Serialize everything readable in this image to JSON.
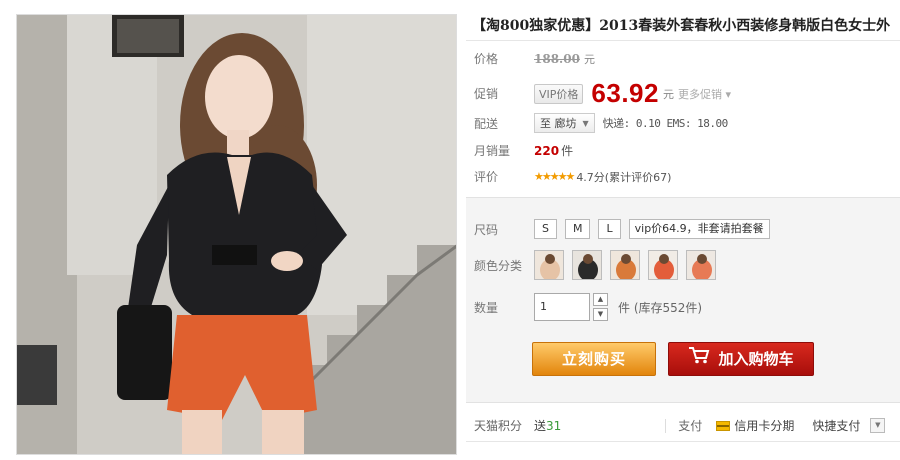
{
  "product": {
    "title": "【淘800独家优惠】2013春装外套春秋小西装修身韩版白色女士外"
  },
  "price": {
    "label": "价格",
    "original": "188.00",
    "unit": "元"
  },
  "promo": {
    "label": "促销",
    "tag": "VIP价格",
    "price": "63.92",
    "unit": "元",
    "more": "更多促销"
  },
  "shipping": {
    "label": "配送",
    "destination": "至 廊坊",
    "info": "快递: 0.10 EMS: 18.00"
  },
  "sales": {
    "label": "月销量",
    "count": "220",
    "unit": "件"
  },
  "rating": {
    "label": "评价",
    "stars": "★★★★★",
    "text": "4.7分(累计评价67)"
  },
  "size": {
    "label": "尺码",
    "options": [
      "S",
      "M",
      "L",
      "vip价64.9，非套请拍套餐"
    ]
  },
  "color": {
    "label": "颜色分类",
    "swatch_colors": [
      "#e6c3a6",
      "#2a2a2a",
      "#d97a3a",
      "#e35d3a",
      "#e77a55"
    ]
  },
  "quantity": {
    "label": "数量",
    "value": "1",
    "stock": "件 (库存552件)"
  },
  "actions": {
    "buy": "立刻购买",
    "cart": "加入购物车"
  },
  "footer": {
    "points_label": "天猫积分",
    "points_prefix": "送",
    "points_value": "31",
    "pay_label": "支付",
    "credit": "信用卡分期",
    "quick_pay": "快捷支付"
  },
  "colors": {
    "price_red": "#c40000",
    "buy_orange": "#e2850c",
    "cart_red": "#c4180f"
  }
}
